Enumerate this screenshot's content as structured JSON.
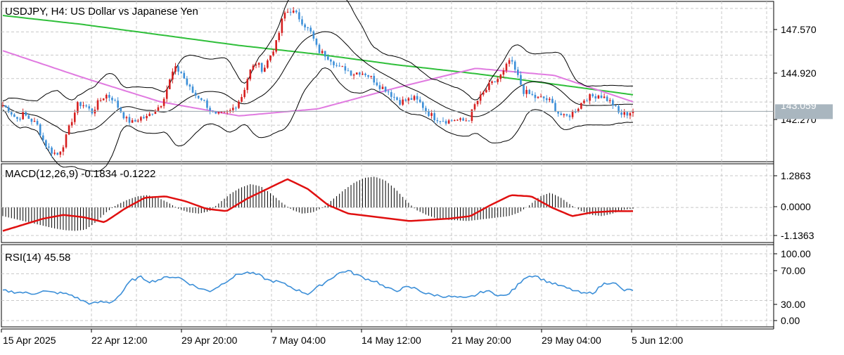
{
  "colors": {
    "bull": "#d61f1f",
    "bear": "#3c8fd8",
    "ma_green": "#2fbf3a",
    "ma_pink": "#e07ae0",
    "bollinger": "#000000",
    "macd_signal": "#e01010",
    "macd_hist": "#000000",
    "rsi": "#3c8fd8",
    "grid": "#c8c8c8",
    "price_line": "#9aa4ab",
    "price_tag": "#a9b6bf"
  },
  "main_panel": {
    "title": "USDJPY, H4:  US Dollar vs Japanese Yen",
    "price_labels": [
      "147.570",
      "144.920",
      "142.270"
    ],
    "current_price": "143.059"
  },
  "macd_panel": {
    "title": "MACD(12,26,9) -0.1834 -0.1222",
    "labels": [
      "1.2863",
      "0.0000",
      "-1.1363"
    ]
  },
  "rsi_panel": {
    "title": "RSI(14) 45.58",
    "labels": [
      "100.00",
      "70.00",
      "30.00",
      "0.00"
    ]
  },
  "x_axis": {
    "labels": [
      "15 Apr 2025",
      "22 Apr 12:00",
      "29 Apr 20:00",
      "7 May 04:00",
      "14 May 12:00",
      "21 May 20:00",
      "29 May 04:00",
      "5 Jun 12:00"
    ]
  },
  "chart_data": [
    {
      "type": "candlestick",
      "title": "USDJPY, H4:  US Dollar vs Japanese Yen",
      "ylim": [
        140.2,
        149.3
      ],
      "x_ticks": [
        "15 Apr 2025",
        "22 Apr 12:00",
        "29 Apr 20:00",
        "7 May 04:00",
        "14 May 12:00",
        "21 May 20:00",
        "29 May 04:00",
        "5 Jun 12:00"
      ],
      "y_ticks": [
        147.57,
        144.92,
        142.27
      ],
      "close_path": [
        143.4,
        143.1,
        142.6,
        142.9,
        142.6,
        142.3,
        141.3,
        140.8,
        140.6,
        141.3,
        142.5,
        143.5,
        143.4,
        143.0,
        143.6,
        144.0,
        143.8,
        143.2,
        142.6,
        142.4,
        142.7,
        142.7,
        143.1,
        143.4,
        144.4,
        145.5,
        145.3,
        144.5,
        144.0,
        143.8,
        143.3,
        142.8,
        142.9,
        143.0,
        143.4,
        144.0,
        145.3,
        145.8,
        145.4,
        146.2,
        147.0,
        148.6,
        148.8,
        148.5,
        148.0,
        147.5,
        146.5,
        146.3,
        146.0,
        145.5,
        145.5,
        145.2,
        145.3,
        145.2,
        144.9,
        144.5,
        144.3,
        143.9,
        143.6,
        143.7,
        143.8,
        143.5,
        143.0,
        142.7,
        142.6,
        142.5,
        142.6,
        142.5,
        142.6,
        143.5,
        144.0,
        144.5,
        144.8,
        145.2,
        146.0,
        145.2,
        144.2,
        144.0,
        143.8,
        143.8,
        143.6,
        143.0,
        142.7,
        142.9,
        143.3,
        143.8,
        143.9,
        144.0,
        143.8,
        143.5,
        142.9,
        142.9,
        143.1
      ],
      "current_price": 143.059,
      "series": [
        {
          "name": "MA green",
          "values": [
            148.5,
            148.0,
            147.4,
            146.8,
            146.3,
            145.7,
            145.2,
            144.6,
            144.0
          ]
        },
        {
          "name": "MA pink",
          "values": [
            146.5,
            145.0,
            143.6,
            142.8,
            143.2,
            144.4,
            145.5,
            145.1,
            143.6
          ]
        }
      ]
    },
    {
      "type": "bar",
      "title": "MACD(12,26,9) -0.1834 -0.1222",
      "ylim": [
        -1.1363,
        1.2863
      ],
      "y_ticks": [
        1.2863,
        0.0,
        -1.1363
      ],
      "macd_value": -0.1834,
      "signal_value": -0.1222,
      "histogram": [
        -0.35,
        -0.45,
        -0.55,
        -0.65,
        -0.75,
        -0.85,
        -0.92,
        -0.95,
        -0.9,
        -0.6,
        -0.2,
        0.1,
        0.3,
        0.45,
        0.5,
        0.4,
        0.2,
        -0.05,
        -0.2,
        -0.25,
        -0.15,
        0.2,
        0.55,
        0.8,
        0.95,
        0.85,
        0.55,
        0.2,
        -0.1,
        -0.25,
        -0.2,
        0.0,
        0.35,
        0.7,
        1.0,
        1.2,
        1.25,
        1.1,
        0.75,
        0.3,
        -0.1,
        -0.3,
        -0.45,
        -0.5,
        -0.52,
        -0.55,
        -0.5,
        -0.45,
        -0.4,
        -0.35,
        -0.2,
        0.1,
        0.45,
        0.6,
        0.4,
        0.1,
        -0.15,
        -0.3,
        -0.35,
        -0.25,
        -0.1,
        -0.05
      ],
      "signal_path": [
        -0.95,
        -0.7,
        -0.45,
        -0.3,
        -0.4,
        -0.6,
        -0.05,
        0.4,
        0.45,
        0.25,
        -0.05,
        -0.15,
        0.35,
        0.75,
        1.15,
        0.75,
        0.1,
        -0.25,
        -0.35,
        -0.45,
        -0.55,
        -0.5,
        -0.45,
        -0.35,
        0.1,
        0.5,
        0.45,
        0.0,
        -0.35,
        -0.2,
        -0.15,
        -0.15
      ]
    },
    {
      "type": "line",
      "title": "RSI(14) 45.58",
      "ylim": [
        0,
        100
      ],
      "y_ticks": [
        100,
        70,
        30,
        0
      ],
      "series": [
        {
          "values": [
            45,
            43,
            42,
            40,
            44,
            42,
            41,
            38,
            30,
            25,
            28,
            27,
            40,
            60,
            65,
            58,
            62,
            66,
            64,
            55,
            48,
            44,
            52,
            62,
            70,
            72,
            68,
            60,
            58,
            52,
            45,
            40,
            50,
            60,
            70,
            75,
            68,
            62,
            58,
            48,
            45,
            50,
            48,
            40,
            38,
            36,
            35,
            33,
            38,
            45,
            40,
            36,
            48,
            65,
            68,
            60,
            55,
            50,
            45,
            40,
            42,
            55,
            58,
            45,
            46
          ]
        }
      ]
    }
  ]
}
